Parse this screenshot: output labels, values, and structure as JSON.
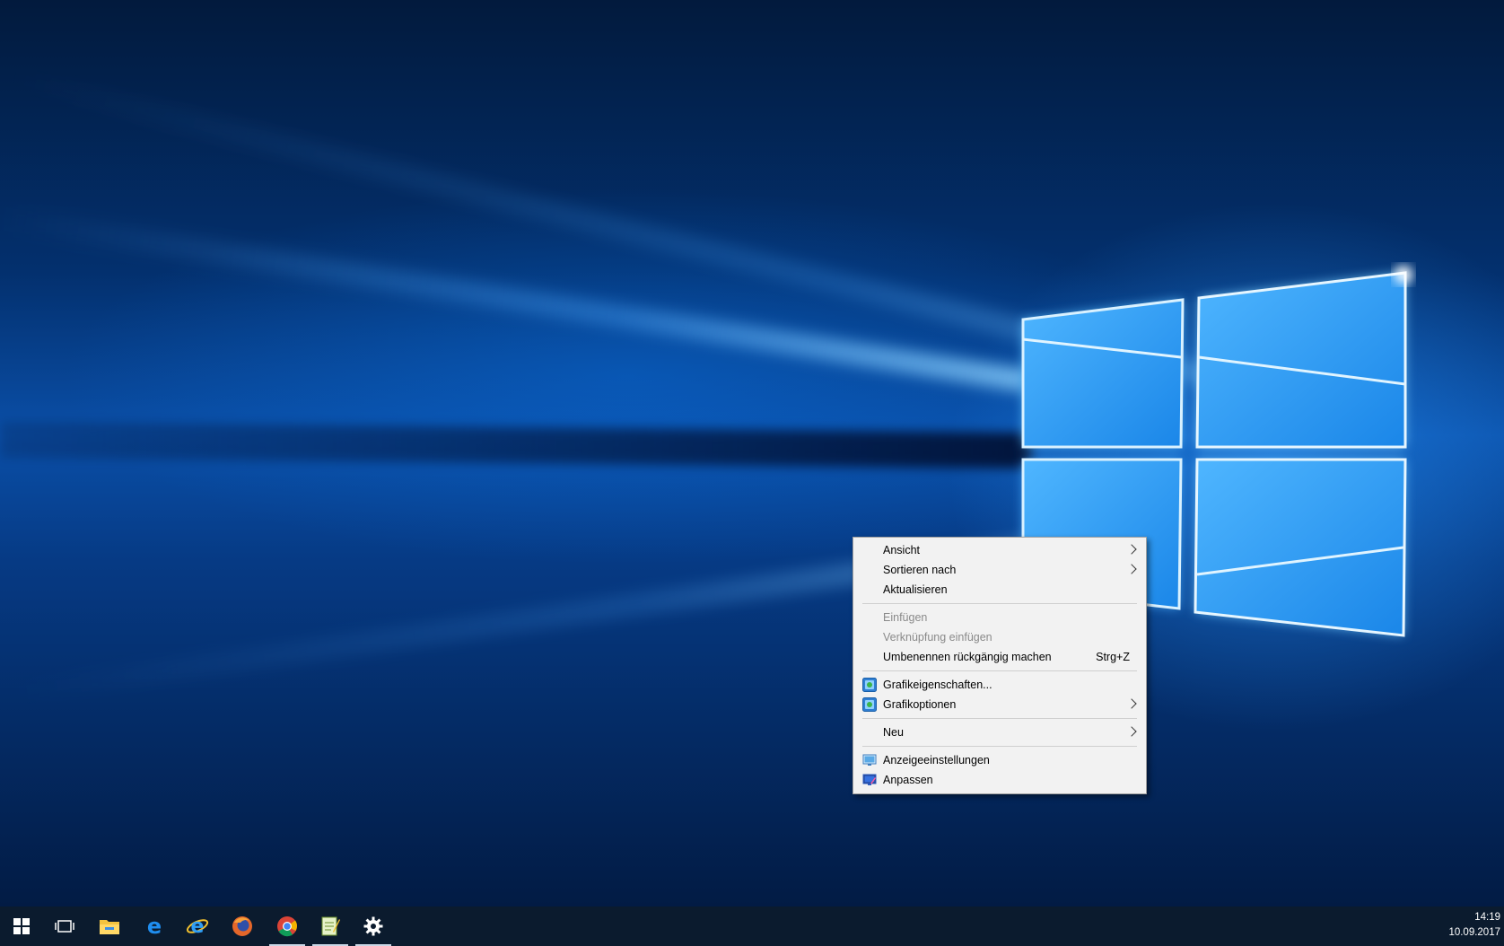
{
  "context_menu": {
    "items": [
      {
        "label": "Ansicht",
        "submenu": true
      },
      {
        "label": "Sortieren nach",
        "submenu": true
      },
      {
        "label": "Aktualisieren"
      },
      {
        "label": "Einfügen",
        "disabled": true
      },
      {
        "label": "Verknüpfung einfügen",
        "disabled": true
      },
      {
        "label": "Umbenennen rückgängig machen",
        "shortcut": "Strg+Z"
      },
      {
        "label": "Grafikeigenschaften...",
        "icon": "intel-graphics-icon"
      },
      {
        "label": "Grafikoptionen",
        "icon": "intel-graphics-icon",
        "submenu": true
      },
      {
        "label": "Neu",
        "submenu": true
      },
      {
        "label": "Anzeigeeinstellungen",
        "icon": "display-settings-icon"
      },
      {
        "label": "Anpassen",
        "icon": "personalize-icon"
      }
    ]
  },
  "taskbar": {
    "apps": [
      {
        "name": "start-button",
        "icon": "windows-logo-icon"
      },
      {
        "name": "task-view-button",
        "icon": "task-view-icon"
      },
      {
        "name": "file-explorer",
        "icon": "folder-icon"
      },
      {
        "name": "microsoft-edge",
        "icon": "edge-icon"
      },
      {
        "name": "internet-explorer",
        "icon": "internet-explorer-icon"
      },
      {
        "name": "firefox",
        "icon": "firefox-icon"
      },
      {
        "name": "chrome",
        "icon": "chrome-icon",
        "active": true
      },
      {
        "name": "notepad-app",
        "icon": "notepad-icon",
        "active": true
      },
      {
        "name": "settings",
        "icon": "gear-icon",
        "active": true
      }
    ]
  },
  "clock": {
    "time": "14:19",
    "date": "10.09.2017"
  }
}
